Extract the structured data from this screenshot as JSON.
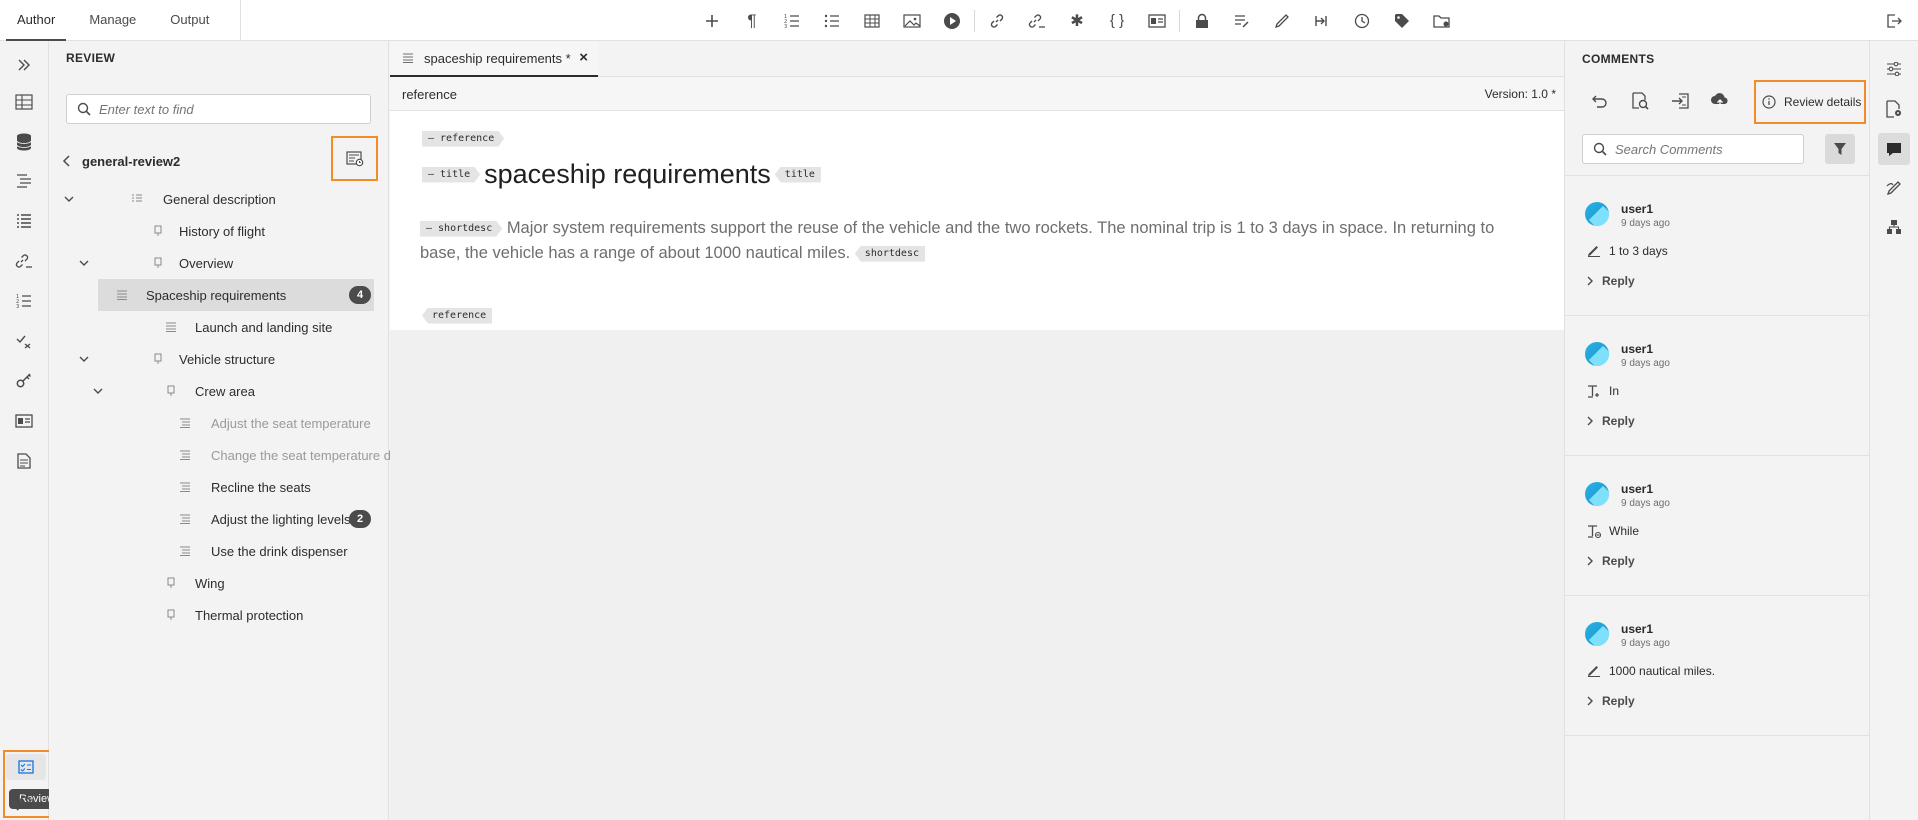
{
  "header": {
    "tabs": [
      {
        "label": "Author"
      },
      {
        "label": "Manage"
      },
      {
        "label": "Output"
      }
    ],
    "toolbar_icons": [
      "plus-icon",
      "paragraph-icon",
      "numbered-list-icon",
      "bulleted-list-icon",
      "table-icon",
      "image-icon",
      "multimedia-icon",
      "link-icon",
      "cross-reference-icon",
      "special-character-icon",
      "code-braces-icon",
      "content-reference-icon",
      "lock-icon",
      "track-changes-icon",
      "highlight-icon",
      "version-compare-icon",
      "history-icon",
      "tag-icon",
      "folder-settings-icon"
    ]
  },
  "left_rail": {
    "icons": [
      "expand-panels-icon",
      "repository-icon",
      "database-icon",
      "outline-icon",
      "list-icon",
      "reusable-content-icon",
      "numbered-list-icon",
      "review-tasks-icon",
      "key-icon",
      "citation-icon",
      "document-icon"
    ],
    "review_icon": "review-icon",
    "review_tooltip": "Review",
    "bottom_icon": "find-replace-icon"
  },
  "review_panel": {
    "title": "REVIEW",
    "search_placeholder": "Enter text to find",
    "review_name": "general-review2",
    "tree": [
      {
        "label": "General description",
        "level": 0,
        "expanded": true,
        "type": "map"
      },
      {
        "label": "History of flight",
        "level": 1,
        "type": "topic"
      },
      {
        "label": "Overview",
        "level": 1,
        "expanded": true,
        "type": "topic"
      },
      {
        "label": "Spaceship requirements",
        "level": 2,
        "type": "reference",
        "selected": true,
        "count": "4"
      },
      {
        "label": "Launch and landing site",
        "level": 2,
        "type": "reference"
      },
      {
        "label": "Vehicle structure",
        "level": 1,
        "expanded": true,
        "type": "topic"
      },
      {
        "label": "Crew area",
        "level": 2,
        "expanded": true,
        "type": "topic"
      },
      {
        "label": "Adjust the seat temperature",
        "level": 3,
        "type": "task",
        "dim": true
      },
      {
        "label": "Change the seat temperature disp...",
        "level": 3,
        "type": "task",
        "dim": true
      },
      {
        "label": "Recline the seats",
        "level": 3,
        "type": "task"
      },
      {
        "label": "Adjust the lighting levels",
        "level": 3,
        "type": "task",
        "count": "2"
      },
      {
        "label": "Use the drink dispenser",
        "level": 3,
        "type": "task"
      },
      {
        "label": "Wing",
        "level": 2,
        "type": "topic"
      },
      {
        "label": "Thermal protection",
        "level": 2,
        "type": "topic"
      }
    ]
  },
  "editor": {
    "tab_title": "spaceship requirements *",
    "breadcrumb": "reference",
    "version": "Version: 1.0 *",
    "tags": {
      "reference": "reference",
      "title": "title",
      "shortdesc": "shortdesc"
    },
    "title_text": "spaceship requirements",
    "shortdesc_text": "Major system requirements support the reuse of the vehicle and the two rockets. The nominal trip is 1 to 3 days in space. In returning to base, the vehicle has a range of about 1000 nautical miles."
  },
  "comments_panel": {
    "title": "COMMENTS",
    "tool_icons": [
      "undo-icon",
      "find-comment-icon",
      "import-icon",
      "upload-cloud-icon"
    ],
    "review_details_label": "Review details",
    "search_placeholder": "Search Comments",
    "comments": [
      {
        "user": "user1",
        "time": "9 days ago",
        "kind": "highlight",
        "text": "1 to 3 days",
        "reply": "Reply"
      },
      {
        "user": "user1",
        "time": "9 days ago",
        "kind": "insert-text",
        "text": "In",
        "reply": "Reply"
      },
      {
        "user": "user1",
        "time": "9 days ago",
        "kind": "delete-text",
        "text": "While",
        "reply": "Reply"
      },
      {
        "user": "user1",
        "time": "9 days ago",
        "kind": "highlight",
        "text": "1000 nautical miles.",
        "reply": "Reply"
      }
    ]
  },
  "right_rail": {
    "icons": [
      "properties-icon",
      "file-settings-icon",
      "comments-icon",
      "track-changes-panel-icon",
      "component-icon"
    ],
    "active": "comments-icon"
  },
  "colors": {
    "highlight_border": "#f28c28",
    "avatar": "#2bb3e6",
    "badge": "#4b4b4b"
  }
}
